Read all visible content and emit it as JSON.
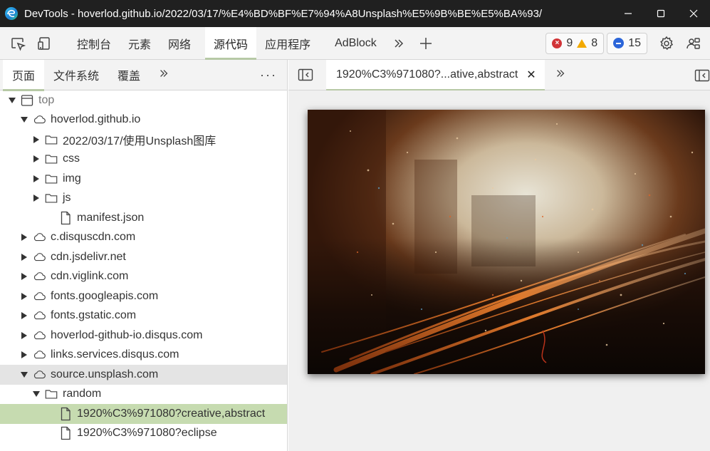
{
  "window": {
    "title": "DevTools - hoverlod.github.io/2022/03/17/%E4%BD%BF%E7%94%A8Unsplash%E5%9B%BE%E5%BA%93/",
    "app_icon": "edge-logo",
    "controls": [
      "minimize-icon",
      "maximize-icon",
      "close-icon"
    ]
  },
  "toolbar": {
    "left_icons": [
      "inspect-element-icon",
      "device-emulation-icon"
    ],
    "tabs": [
      {
        "label": "控制台"
      },
      {
        "label": "元素"
      },
      {
        "label": "网络"
      },
      {
        "label": "源代码",
        "active": true
      },
      {
        "label": "应用程序"
      },
      {
        "label": "AdBlock"
      }
    ],
    "more_tabs_icon": "chevron-double-right-icon",
    "add_tab_icon": "plus-icon",
    "errors": "9",
    "warnings": "8",
    "messages": "15",
    "right_icons": [
      "settings-gear-icon",
      "customize-icon"
    ]
  },
  "navigator": {
    "tabs": [
      {
        "label": "页面",
        "active": true
      },
      {
        "label": "文件系统"
      },
      {
        "label": "覆盖"
      }
    ],
    "more_icon": "chevron-double-right-icon",
    "menu_icon": "more-dots-icon",
    "tree": [
      {
        "label": "top",
        "depth": 0,
        "expanded": true,
        "icon": "frame-icon",
        "muted": true
      },
      {
        "label": "hoverlod.github.io",
        "depth": 1,
        "expanded": true,
        "icon": "cloud-icon"
      },
      {
        "label": "2022/03/17/使用Unsplash图库",
        "depth": 2,
        "expanded": false,
        "icon": "folder-icon"
      },
      {
        "label": "css",
        "depth": 2,
        "expanded": false,
        "icon": "folder-icon"
      },
      {
        "label": "img",
        "depth": 2,
        "expanded": false,
        "icon": "folder-icon"
      },
      {
        "label": "js",
        "depth": 2,
        "expanded": false,
        "icon": "folder-icon"
      },
      {
        "label": "manifest.json",
        "depth": 3,
        "icon": "file-icon"
      },
      {
        "label": "c.disquscdn.com",
        "depth": 1,
        "expanded": false,
        "icon": "cloud-icon"
      },
      {
        "label": "cdn.jsdelivr.net",
        "depth": 1,
        "expanded": false,
        "icon": "cloud-icon"
      },
      {
        "label": "cdn.viglink.com",
        "depth": 1,
        "expanded": false,
        "icon": "cloud-icon"
      },
      {
        "label": "fonts.googleapis.com",
        "depth": 1,
        "expanded": false,
        "icon": "cloud-icon"
      },
      {
        "label": "fonts.gstatic.com",
        "depth": 1,
        "expanded": false,
        "icon": "cloud-icon"
      },
      {
        "label": "hoverlod-github-io.disqus.com",
        "depth": 1,
        "expanded": false,
        "icon": "cloud-icon"
      },
      {
        "label": "links.services.disqus.com",
        "depth": 1,
        "expanded": false,
        "icon": "cloud-icon"
      },
      {
        "label": "source.unsplash.com",
        "depth": 1,
        "expanded": true,
        "icon": "cloud-icon",
        "state": "hover"
      },
      {
        "label": "random",
        "depth": 2,
        "expanded": true,
        "icon": "folder-icon"
      },
      {
        "label": "1920%C3%971080?creative,abstract",
        "depth": 3,
        "icon": "file-icon",
        "state": "selected"
      },
      {
        "label": "1920%C3%971080?eclipse",
        "depth": 3,
        "icon": "file-icon"
      }
    ]
  },
  "editor": {
    "toggle_navigator_icon": "toggle-navigator-icon",
    "open_file_tab": "1920%C3%971080?...ative,abstract",
    "close_icon": "close-icon",
    "more_icon": "chevron-double-right-icon",
    "toggle_debugger_icon": "toggle-debugger-icon",
    "preview": {
      "description": "abstract-dark-orange-photo",
      "colors": {
        "dark": "#1a0d07",
        "orange": "#c4581c",
        "light": "#e8e4d6",
        "mid": "#5a2d14"
      }
    }
  },
  "colors": {
    "titlebar": "#202020",
    "accent_underline": "#b7c9a6",
    "selected_row": "#c6dbb0",
    "hover_row": "#e4e4e4",
    "error": "#d13438",
    "warning": "#f2a900",
    "message": "#2b65d9"
  }
}
